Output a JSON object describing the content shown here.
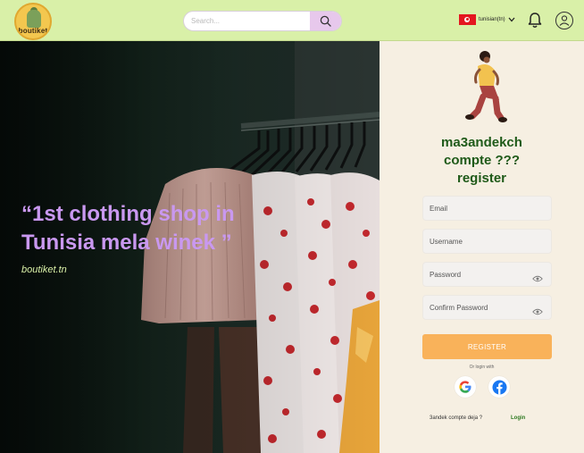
{
  "brand": {
    "logo_text": "boutiket"
  },
  "header": {
    "search_placeholder": "Search...",
    "language_label": "tunisian(tn)",
    "icons": {
      "search": "search-icon",
      "language_dropdown": "chevron-down-icon",
      "notifications": "bell-icon",
      "profile": "user-icon",
      "flag": "tunisia-flag-icon"
    }
  },
  "hero": {
    "quote": "“1st  clothing shop in Tunisia mela winek ”",
    "site": "boutiket.tn"
  },
  "register": {
    "title_line1": "ma3andekch",
    "title_line2": "compte ???",
    "title_line3": "register",
    "email_placeholder": "Email",
    "username_placeholder": "Username",
    "password_placeholder": "Password",
    "confirm_password_placeholder": "Confirm Password",
    "button_label": "REGISTER",
    "or_login_with": "Or login with",
    "have_account_text": "3andek compte deja ?",
    "login_link": "Login"
  },
  "colors": {
    "header_bg": "#d9f0a8",
    "panel_bg": "#f6efe2",
    "accent_green": "#1f5a19",
    "quote_purple": "#c998f0",
    "register_orange": "#f9b25a",
    "search_btn": "#e7c8ec"
  }
}
